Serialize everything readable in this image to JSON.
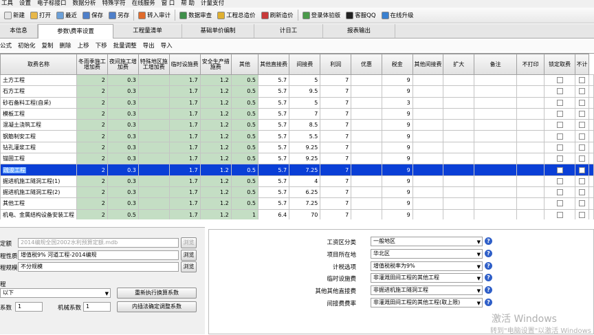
{
  "menu": [
    "工具",
    "设置",
    "电子标接口",
    "数据分析",
    "特殊字符",
    "在线服务",
    "窗 口",
    "帮 助",
    "计量支付"
  ],
  "toolbar": {
    "items": [
      {
        "label": "新建",
        "color": "#e5e5e5"
      },
      {
        "label": "打开",
        "color": "#e8b84a"
      },
      {
        "label": "最近",
        "color": "#6ba0d8"
      },
      {
        "label": "保存",
        "color": "#4f7fc9"
      },
      {
        "label": "另存",
        "color": "#4f7fc9"
      },
      {
        "label": "转入审计",
        "color": "#e06a2a"
      },
      {
        "label": "数据审查",
        "color": "#3e8f4a"
      },
      {
        "label": "工程总造价",
        "color": "#e0b030"
      },
      {
        "label": "刷新造价",
        "color": "#c83a3a"
      },
      {
        "label": "登录体验版",
        "color": "#4a9a4a"
      },
      {
        "label": "客服QQ",
        "color": "#222222"
      },
      {
        "label": "在线升级",
        "color": "#3a80d0"
      }
    ]
  },
  "tabs": [
    "本信息",
    "参数\\费率设置",
    "工程量清单",
    "基础单价编制",
    "计日工",
    "报表输出"
  ],
  "subtoolbar": [
    "公式",
    "初始化",
    "复制",
    "删除",
    "上移",
    "下移",
    "批量调整",
    "导出",
    "导入"
  ],
  "grid": {
    "headers": [
      "取费名称",
      "冬雨季施工增加费",
      "夜间施工增加费",
      "特殊地区施工增加费",
      "临时设施费",
      "安全生产措施费",
      "其他",
      "其他直接费",
      "间接费",
      "利润",
      "优惠",
      "税金",
      "其他间接费",
      "扩大",
      "备注",
      "不打印",
      "锁定取费",
      "不计"
    ],
    "rows": [
      {
        "name": "土方工程",
        "v": [
          "2",
          "0.3",
          "",
          "1.7",
          "1.2",
          "0.5",
          "5.7",
          "5",
          "7",
          "",
          "9",
          "",
          "",
          "",
          ""
        ]
      },
      {
        "name": "石方工程",
        "v": [
          "2",
          "0.3",
          "",
          "1.7",
          "1.2",
          "0.5",
          "5.7",
          "9.5",
          "7",
          "",
          "9",
          "",
          "",
          "",
          ""
        ]
      },
      {
        "name": "砂石备料工程(自采)",
        "v": [
          "2",
          "0.3",
          "",
          "1.7",
          "1.2",
          "0.5",
          "5.7",
          "5",
          "7",
          "",
          "3",
          "",
          "",
          "",
          ""
        ]
      },
      {
        "name": "模板工程",
        "v": [
          "2",
          "0.3",
          "",
          "1.7",
          "1.2",
          "0.5",
          "5.7",
          "7",
          "7",
          "",
          "9",
          "",
          "",
          "",
          ""
        ]
      },
      {
        "name": "混凝土浇筑工程",
        "v": [
          "2",
          "0.3",
          "",
          "1.7",
          "1.2",
          "0.5",
          "5.7",
          "8.5",
          "7",
          "",
          "9",
          "",
          "",
          "",
          ""
        ]
      },
      {
        "name": "钢筋制安工程",
        "v": [
          "2",
          "0.3",
          "",
          "1.7",
          "1.2",
          "0.5",
          "5.7",
          "5.5",
          "7",
          "",
          "9",
          "",
          "",
          "",
          ""
        ]
      },
      {
        "name": "钻孔灌浆工程",
        "v": [
          "2",
          "0.3",
          "",
          "1.7",
          "1.2",
          "0.5",
          "5.7",
          "9.25",
          "7",
          "",
          "9",
          "",
          "",
          "",
          ""
        ]
      },
      {
        "name": "锚固工程",
        "v": [
          "2",
          "0.3",
          "",
          "1.7",
          "1.2",
          "0.5",
          "5.7",
          "9.25",
          "7",
          "",
          "9",
          "",
          "",
          "",
          ""
        ]
      },
      {
        "name": "疏浚工程",
        "v": [
          "2",
          "0.3",
          "",
          "1.7",
          "1.2",
          "0.5",
          "5.7",
          "7.25",
          "7",
          "",
          "9",
          "",
          "",
          "",
          ""
        ],
        "selected": true
      },
      {
        "name": "掘进机施工隧洞工程(1)",
        "v": [
          "2",
          "0.3",
          "",
          "1.7",
          "1.2",
          "0.5",
          "5.7",
          "4",
          "7",
          "",
          "9",
          "",
          "",
          "",
          ""
        ]
      },
      {
        "name": "掘进机施工隧洞工程(2)",
        "v": [
          "2",
          "0.3",
          "",
          "1.7",
          "1.2",
          "0.5",
          "5.7",
          "6.25",
          "7",
          "",
          "9",
          "",
          "",
          "",
          ""
        ]
      },
      {
        "name": "其他工程",
        "v": [
          "2",
          "0.3",
          "",
          "1.7",
          "1.2",
          "0.5",
          "5.7",
          "7.25",
          "7",
          "",
          "9",
          "",
          "",
          "",
          ""
        ]
      },
      {
        "name": "机电、金属结构设备安装工程",
        "v": [
          "2",
          "0.5",
          "",
          "1.7",
          "1.2",
          "1",
          "6.4",
          "70",
          "7",
          "",
          "9",
          "",
          "",
          "",
          ""
        ]
      }
    ]
  },
  "left_panel": {
    "quota_label": "定额",
    "quota_value": "2014编规全国2002水利预算定额.mdb",
    "browse1": "浏览",
    "nature_label": "程性质",
    "nature_value": "增值税9%  河道工程-2014编规",
    "browse2": "浏览",
    "scale_label": "程规模",
    "scale_value": "不分规模",
    "browse3": "浏览",
    "group_label": "程",
    "combo_value": "以下",
    "recalc_btn": "重新执行换算系数",
    "coef_label": "系数",
    "coef_value": "1",
    "mech_label": "机械系数",
    "mech_value": "1",
    "interp_btn": "内插法确定调整系数"
  },
  "right_panel": {
    "fields": [
      {
        "label": "工资区分类",
        "value": "一般地区"
      },
      {
        "label": "项目所在地",
        "value": "华北区"
      },
      {
        "label": "计税选项",
        "value": "增值税税率为9%"
      },
      {
        "label": "临时设施费",
        "value": "非灌溉田间工程的其他工程"
      },
      {
        "label": "其他其他直接费",
        "value": "非掘进机施工隧洞工程"
      },
      {
        "label": "间接费费率",
        "value": "非灌溉田间工程的其他工程(取上限)"
      }
    ]
  },
  "watermark": {
    "line1": "激活 Windows",
    "line2": "转到\"电脑设置\"以激活 Windows"
  }
}
